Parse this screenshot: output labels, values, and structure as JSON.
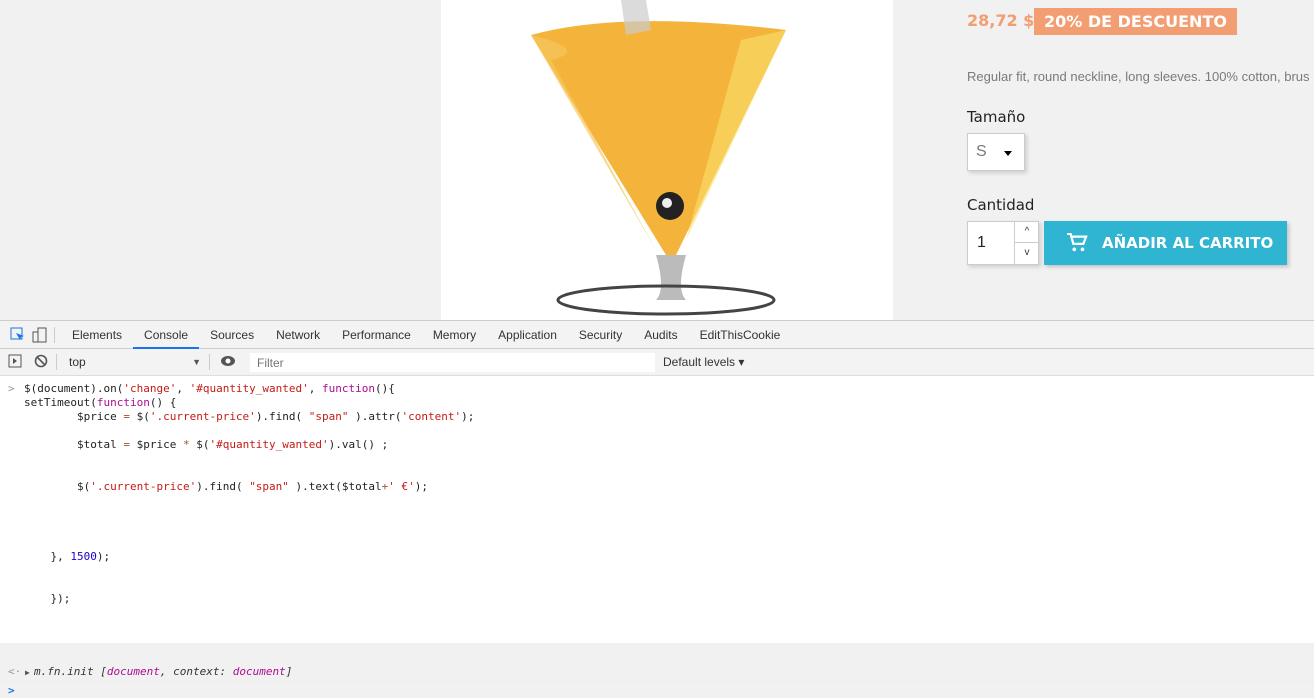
{
  "product": {
    "price": "28,72 $",
    "discount": "20% DE DESCUENTO",
    "description": "Regular fit, round neckline, long sleeves. 100% cotton, brus",
    "size_label": "Tamaño",
    "size_value": "S",
    "qty_label": "Cantidad",
    "qty_value": "1",
    "add_to_cart": "AÑADIR AL CARRITO"
  },
  "devtools": {
    "tabs": [
      "Elements",
      "Console",
      "Sources",
      "Network",
      "Performance",
      "Memory",
      "Application",
      "Security",
      "Audits",
      "EditThisCookie"
    ],
    "active_tab": "Console",
    "context": "top",
    "filter_placeholder": "Filter",
    "levels": "Default levels ▾",
    "code_lines": [
      [
        [
          "p",
          "$(document).on("
        ],
        [
          "s",
          "'change'"
        ],
        [
          "p",
          ", "
        ],
        [
          "s",
          "'#quantity_wanted'"
        ],
        [
          "p",
          ", "
        ],
        [
          "k",
          "function"
        ],
        [
          "p",
          "(){"
        ]
      ],
      [
        [
          "p",
          "setTimeout("
        ],
        [
          "k",
          "function"
        ],
        [
          "p",
          "() {"
        ]
      ],
      [
        [
          "p",
          "        $price "
        ],
        [
          "o",
          "="
        ],
        [
          "p",
          " $("
        ],
        [
          "s",
          "'.current-price'"
        ],
        [
          "p",
          ").find( "
        ],
        [
          "s",
          "\"span\""
        ],
        [
          "p",
          " ).attr("
        ],
        [
          "s",
          "'content'"
        ],
        [
          "p",
          ");"
        ]
      ],
      [],
      [
        [
          "p",
          "        $total "
        ],
        [
          "o",
          "="
        ],
        [
          "p",
          " $price "
        ],
        [
          "o",
          "*"
        ],
        [
          "p",
          " $("
        ],
        [
          "s",
          "'#quantity_wanted'"
        ],
        [
          "p",
          ").val() ;"
        ]
      ],
      [],
      [],
      [
        [
          "p",
          "        $("
        ],
        [
          "s",
          "'.current-price'"
        ],
        [
          "p",
          ").find( "
        ],
        [
          "s",
          "\"span\""
        ],
        [
          "p",
          " ).text($total"
        ],
        [
          "o",
          "+"
        ],
        [
          "s",
          "' €'"
        ],
        [
          "p",
          ");"
        ]
      ],
      [],
      [],
      [],
      [],
      [
        [
          "p",
          "    }, "
        ],
        [
          "n",
          "1500"
        ],
        [
          "p",
          ");"
        ]
      ],
      [],
      [],
      [
        [
          "p",
          "    });"
        ]
      ]
    ],
    "result": {
      "prefix": "m.fn.init [",
      "arg1": "document",
      "mid": ", context: ",
      "arg2": "document",
      "suffix": "]"
    }
  }
}
